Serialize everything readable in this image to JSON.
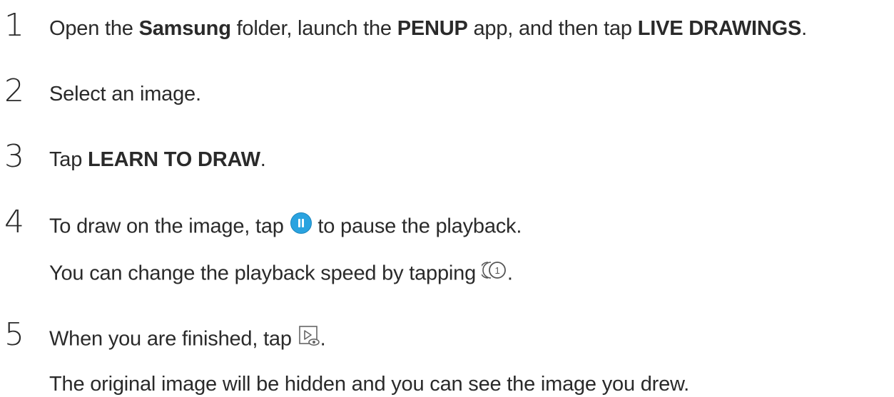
{
  "steps": [
    {
      "number": "1",
      "parts": [
        {
          "text": "Open the ",
          "bold": false
        },
        {
          "text": "Samsung",
          "bold": true
        },
        {
          "text": " folder, launch the ",
          "bold": false
        },
        {
          "text": "PENUP",
          "bold": true
        },
        {
          "text": " app, and then tap ",
          "bold": false
        },
        {
          "text": "LIVE DRAWINGS",
          "bold": true
        },
        {
          "text": ".",
          "bold": false
        }
      ]
    },
    {
      "number": "2",
      "text": "Select an image."
    },
    {
      "number": "3",
      "prefix": "Tap ",
      "bold": "LEARN TO DRAW",
      "suffix": "."
    },
    {
      "number": "4",
      "line1_before": "To draw on the image, tap ",
      "line1_icon": "pause-icon",
      "line1_after": " to pause the playback.",
      "line2_before": "You can change the playback speed by tapping ",
      "line2_icon": "playback-speed-icon",
      "line2_after": "."
    },
    {
      "number": "5",
      "line1_before": "When you are finished, tap ",
      "line1_icon": "view-drawing-icon",
      "line1_after": ".",
      "line2": "The original image will be hidden and you can see the image you drew."
    }
  ],
  "colors": {
    "text": "#2a2a2a",
    "pause_icon": "#2aa3e0"
  }
}
